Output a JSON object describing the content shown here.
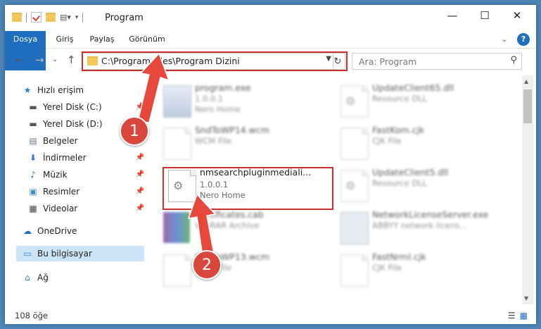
{
  "window": {
    "title": "Program",
    "min_label": "—",
    "max_label": "☐",
    "close_label": "✕"
  },
  "ribbon": {
    "tabs": [
      "Dosya",
      "Giriş",
      "Paylaş",
      "Görünüm"
    ],
    "expand_label": "⌄",
    "help_label": "?"
  },
  "nav": {
    "back": "←",
    "forward": "→",
    "recent": "⌄",
    "up": "↑",
    "path": "C:\\Program Files\\Program Dizini",
    "search_placeholder": "Ara: Program"
  },
  "sidebar": {
    "items": [
      {
        "label": "Hızlı erişim",
        "icon": "star-icon",
        "pinned": false
      },
      {
        "label": "Yerel Disk (C:)",
        "icon": "drive-icon",
        "pinned": true
      },
      {
        "label": "Yerel Disk (D:)",
        "icon": "drive-icon",
        "pinned": true
      },
      {
        "label": "Belgeler",
        "icon": "documents-icon",
        "pinned": true
      },
      {
        "label": "İndirmeler",
        "icon": "download-icon",
        "pinned": true
      },
      {
        "label": "Müzik",
        "icon": "music-icon",
        "pinned": true
      },
      {
        "label": "Resimler",
        "icon": "pictures-icon",
        "pinned": true
      },
      {
        "label": "Videolar",
        "icon": "videos-icon",
        "pinned": true
      },
      {
        "label": "OneDrive",
        "icon": "cloud-icon",
        "pinned": false
      },
      {
        "label": "Bu bilgisayar",
        "icon": "computer-icon",
        "pinned": false
      },
      {
        "label": "Ağ",
        "icon": "network-icon",
        "pinned": false
      }
    ]
  },
  "files": [
    {
      "name": "program.exe",
      "line2": "1.0.0.1",
      "line3": "Nero Home"
    },
    {
      "name": "UpdateClient65.dll",
      "line2": "Resource DLL",
      "line3": ""
    },
    {
      "name": "SndToWP14.wcm",
      "line2": "WCM File",
      "line3": ""
    },
    {
      "name": "FastKom.cjk",
      "line2": "CJK File",
      "line3": ""
    },
    {
      "name": "nmsearchpluginmediali...",
      "line2": "1.0.0.1",
      "line3": "Nero Home"
    },
    {
      "name": "UpdateClient5.dll",
      "line2": "Resource DLL",
      "line3": ""
    },
    {
      "name": "Certificates.cab",
      "line2": "WinRAR Archive",
      "line3": ""
    },
    {
      "name": "NetworkLicenseServer.exe",
      "line2": "ABBYY network licens...",
      "line3": ""
    },
    {
      "name": "SndToWP13.wcm",
      "line2": "WCM File",
      "line3": ""
    },
    {
      "name": "FastNrml.cjk",
      "line2": "CJK File",
      "line3": ""
    }
  ],
  "status": {
    "count": "108 öğe"
  },
  "callouts": [
    "1",
    "2"
  ],
  "colors": {
    "accent": "#1f6ebf",
    "highlight_red": "#c9302c",
    "callout_red": "#d9463b",
    "selection": "#cce4f7"
  }
}
